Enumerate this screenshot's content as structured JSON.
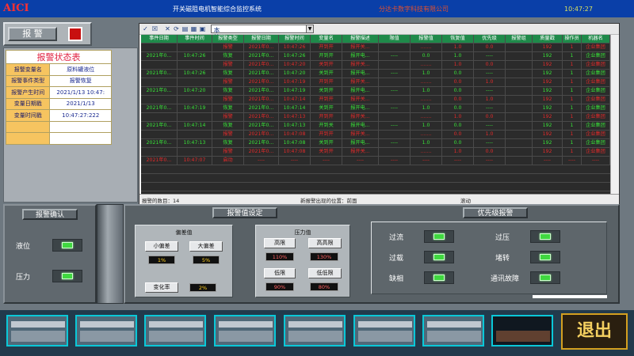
{
  "header": {
    "logo": "AICI",
    "title": "开关磁阻电机智能综合监控系统",
    "company": "分达卡数字科技有限公司",
    "clock": "10:47:27"
  },
  "alarm_button": {
    "label": "报 警"
  },
  "status_table": {
    "title": "报警状态表",
    "rows": [
      {
        "key": "报警变量名",
        "value": "原料罐液位"
      },
      {
        "key": "报警事件类型",
        "value": "报警恢复"
      },
      {
        "key": "报警产生时间",
        "value": "2021/1/13 10:47:"
      },
      {
        "key": "变量日期戳",
        "value": "2021/1/13"
      },
      {
        "key": "变量时间戳",
        "value": "10:47:27:222"
      }
    ]
  },
  "grid": {
    "station": "本站点",
    "headers": [
      "事件日期",
      "事件时间",
      "报警类型",
      "报警日期",
      "报警时间",
      "变量名",
      "报警描述",
      "限值",
      "报警值",
      "恢复值",
      "优先级",
      "报警组",
      "质量戳",
      "操作员",
      "机器名"
    ],
    "rows": [
      {
        "c": [
          "",
          "",
          "报警",
          "2021年0...",
          "10:47:26",
          "开到开",
          "报开关...",
          "",
          ".......",
          "1.0",
          "0.0",
          "",
          "192",
          "1",
          "企业集团"
        ],
        "color": "red"
      },
      {
        "c": [
          "2021年0...",
          "10:47:26",
          "恢复",
          "2021年0...",
          "10:47:26",
          "开到开",
          "报开电...",
          "----",
          "0.0",
          "1.0",
          "----",
          "",
          "192",
          "1",
          "企业集团"
        ],
        "color": "green"
      },
      {
        "c": [
          "",
          "",
          "报警",
          "2021年0...",
          "10:47:20",
          "关到开",
          "报开关...",
          "",
          ".......",
          "1.0",
          "0.0",
          "",
          "192",
          "1",
          "企业集团"
        ],
        "color": "red"
      },
      {
        "c": [
          "2021年0...",
          "10:47:26",
          "恢复",
          "2021年0...",
          "10:47:20",
          "关到开",
          "报开电...",
          "----",
          "1.0",
          "0.0",
          "----",
          "",
          "192",
          "1",
          "企业集团"
        ],
        "color": "green"
      },
      {
        "c": [
          "",
          "",
          "报警",
          "2021年0...",
          "10:47:19",
          "开到开",
          "报开关...",
          "",
          ".......",
          "0.0",
          "1.0",
          "",
          "192",
          "1",
          "企业集团"
        ],
        "color": "red"
      },
      {
        "c": [
          "2021年0...",
          "10:47:20",
          "恢复",
          "2021年0...",
          "10:47:19",
          "关到开",
          "报开电...",
          "----",
          "1.0",
          "0.0",
          "----",
          "",
          "192",
          "1",
          "企业集团"
        ],
        "color": "green"
      },
      {
        "c": [
          "",
          "",
          "报警",
          "2021年0...",
          "10:47:14",
          "开到开",
          "报开关...",
          "",
          ".......",
          "0.0",
          "1.0",
          "",
          "192",
          "1",
          "企业集团"
        ],
        "color": "red"
      },
      {
        "c": [
          "2021年0...",
          "10:47:19",
          "恢复",
          "2021年0...",
          "10:47:14",
          "关到开",
          "报开电...",
          "----",
          "1.0",
          "0.0",
          "----",
          "",
          "192",
          "1",
          "企业集团"
        ],
        "color": "green"
      },
      {
        "c": [
          "",
          "",
          "报警",
          "2021年0...",
          "10:47:13",
          "开到开",
          "报开关...",
          "",
          ".......",
          "1.0",
          "0.0",
          "",
          "192",
          "1",
          "企业集团"
        ],
        "color": "red"
      },
      {
        "c": [
          "2021年0...",
          "10:47:14",
          "恢复",
          "2021年0...",
          "10:47:13",
          "开到关",
          "报开电...",
          "----",
          "1.0",
          "0.0",
          "----",
          "",
          "192",
          "1",
          "企业集团"
        ],
        "color": "green"
      },
      {
        "c": [
          "",
          "",
          "报警",
          "2021年0...",
          "10:47:08",
          "开到开",
          "报开关...",
          "",
          ".......",
          "0.0",
          "1.0",
          "",
          "192",
          "1",
          "企业集团"
        ],
        "color": "red"
      },
      {
        "c": [
          "2021年0...",
          "10:47:13",
          "恢复",
          "2021年0...",
          "10:47:08",
          "关到开",
          "报开电...",
          "----",
          "1.0",
          "0.0",
          "----",
          "",
          "192",
          "1",
          "企业集团"
        ],
        "color": "green"
      },
      {
        "c": [
          "",
          "",
          "报警",
          "2021年0...",
          "10:47:08",
          "关到开",
          "报开关...",
          "",
          ".......",
          "1.0",
          "0.0",
          "",
          "192",
          "1",
          "企业集团"
        ],
        "color": "red"
      },
      {
        "c": [
          "2021年0...",
          "10:47:07",
          "启动",
          "----",
          "----",
          "----",
          "----",
          "----",
          "----",
          "----",
          "----",
          "",
          "----",
          "----",
          "----"
        ],
        "color": "red"
      }
    ],
    "status_count": "报警的数目：14",
    "status_position": "新报警出现的位置：前面",
    "status_scroll": "滚动"
  },
  "left_panel": {
    "title": "报警确认",
    "items": [
      {
        "label": "液位"
      },
      {
        "label": "压力"
      }
    ]
  },
  "limit_panel": {
    "title": "报警值设定",
    "deviation": {
      "title": "偏差值",
      "small_label": "小偏差",
      "small_value": "1%",
      "big_label": "大偏差",
      "big_value": "5%",
      "rate_label": "变化率",
      "rate_value": "2%"
    },
    "pressure": {
      "title": "压力值",
      "high_label": "高限",
      "high_value": "110%",
      "hh_label": "高高限",
      "hh_value": "130%",
      "low_label": "低限",
      "low_value": "90%",
      "ll_label": "低低限",
      "ll_value": "80%"
    }
  },
  "priority_panel": {
    "title": "优先级报警",
    "left": [
      {
        "label": "过流"
      },
      {
        "label": "过载"
      },
      {
        "label": "缺相"
      }
    ],
    "right": [
      {
        "label": "过压"
      },
      {
        "label": "堵转"
      },
      {
        "label": "通讯故障"
      }
    ]
  },
  "exit_button": {
    "label": "退出"
  },
  "colors": {
    "alarm_red": "#e02a2a",
    "recover_green": "#38e038",
    "header_blue": "#0a3fa8"
  }
}
